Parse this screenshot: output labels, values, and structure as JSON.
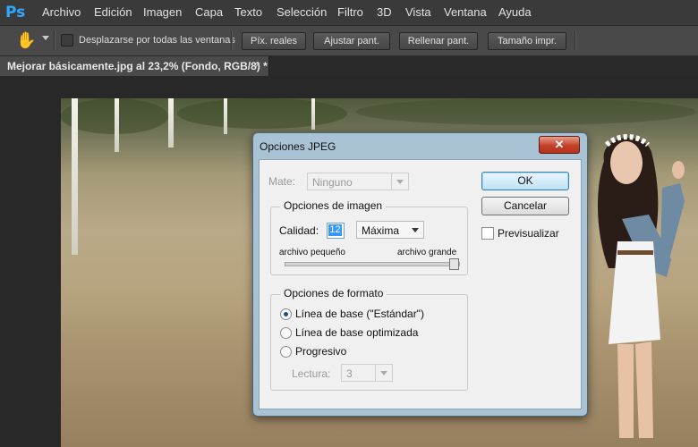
{
  "app": {
    "logo": "Ps"
  },
  "menubar": {
    "items": [
      "Archivo",
      "Edición",
      "Imagen",
      "Capa",
      "Texto",
      "Selección",
      "Filtro",
      "3D",
      "Vista",
      "Ventana",
      "Ayuda"
    ]
  },
  "options_bar": {
    "tool_icon": "hand-icon",
    "scroll_all_windows_label": "Desplazarse por todas las ventanas",
    "buttons": [
      "Píx. reales",
      "Ajustar pant.",
      "Rellenar pant.",
      "Tamaño impr."
    ]
  },
  "document_tab": {
    "title": "Mejorar básicamente.jpg al 23,2% (Fondo, RGB/8) *",
    "close": "×"
  },
  "dialog": {
    "title": "Opciones JPEG",
    "close": "✕",
    "matte": {
      "label": "Mate:",
      "value": "Ninguno"
    },
    "image_options": {
      "legend": "Opciones de imagen",
      "quality_label": "Calidad:",
      "quality_value": "12",
      "quality_preset": "Máxima",
      "small_file": "archivo pequeño",
      "large_file": "archivo grande",
      "slider_level": 1.0
    },
    "format_options": {
      "legend": "Opciones de formato",
      "options": [
        "Línea de base (\"Estándar\")",
        "Línea de base optimizada",
        "Progresivo"
      ],
      "selected": 0,
      "scans_label": "Lectura:",
      "scans_value": "3"
    },
    "ok_label": "OK",
    "cancel_label": "Cancelar",
    "preview_label": "Previsualizar"
  },
  "colors": {
    "menubar_bg": "#3a3a3a",
    "options_bg": "#494949",
    "dialog_frame": "#a9c3d4",
    "close_red": "#c34029",
    "ps_blue": "#31a8ff"
  }
}
